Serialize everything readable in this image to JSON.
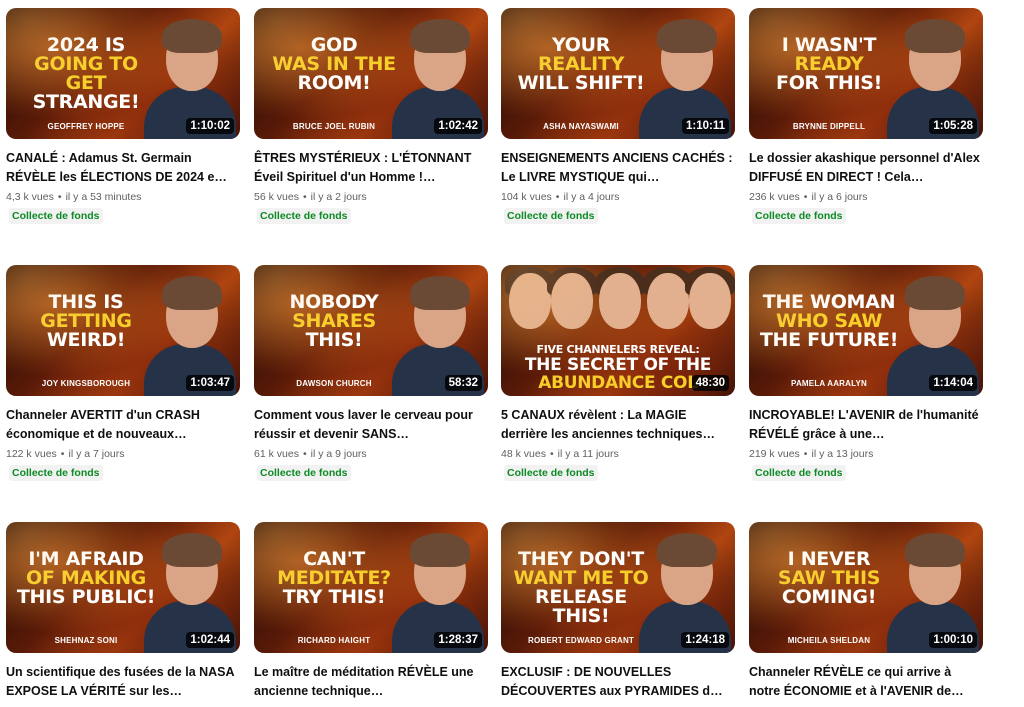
{
  "videos": [
    {
      "title": "CANALÉ : Adamus St. Germain RÉVÈLE les ÉLECTIONS DE 2024 e…",
      "views": "4,3 k vues",
      "age": "il y a 53 minutes",
      "badge": "Collecte de fonds",
      "duration": "1:10:02",
      "speaker": "GEOFFREY HOPPE",
      "headline": [
        {
          "text": "2024 IS",
          "color": "white"
        },
        {
          "text": "GOING TO GET",
          "color": "yellow"
        },
        {
          "text": "STRANGE!",
          "color": "white"
        }
      ]
    },
    {
      "title": "ÊTRES MYSTÉRIEUX : L'ÉTONNANT Éveil Spirituel d'un Homme !…",
      "views": "56 k vues",
      "age": "il y a 2 jours",
      "badge": "Collecte de fonds",
      "duration": "1:02:42",
      "speaker": "BRUCE JOEL RUBIN",
      "headline": [
        {
          "text": "GOD",
          "color": "white"
        },
        {
          "text": "WAS IN THE",
          "color": "yellow"
        },
        {
          "text": "ROOM!",
          "color": "white"
        }
      ]
    },
    {
      "title": "ENSEIGNEMENTS ANCIENS CACHÉS : Le LIVRE MYSTIQUE qui…",
      "views": "104 k vues",
      "age": "il y a 4 jours",
      "badge": "Collecte de fonds",
      "duration": "1:10:11",
      "speaker": "ASHA NAYASWAMI",
      "headline": [
        {
          "text": "YOUR",
          "color": "white"
        },
        {
          "text": "REALITY",
          "color": "yellow"
        },
        {
          "text": "WILL SHIFT!",
          "color": "white"
        }
      ]
    },
    {
      "title": "Le dossier akashique personnel d'Alex DIFFUSÉ EN DIRECT ! Cela…",
      "views": "236 k vues",
      "age": "il y a 6 jours",
      "badge": "Collecte de fonds",
      "duration": "1:05:28",
      "speaker": "BRYNNE DIPPELL",
      "headline": [
        {
          "text": "I WASN'T",
          "color": "white"
        },
        {
          "text": "READY",
          "color": "yellow"
        },
        {
          "text": "FOR THIS!",
          "color": "white"
        }
      ]
    },
    {
      "title": "Channeler AVERTIT d'un CRASH économique et de nouveaux…",
      "views": "122 k vues",
      "age": "il y a 7 jours",
      "badge": "Collecte de fonds",
      "duration": "1:03:47",
      "speaker": "JOY KINGSBOROUGH",
      "headline": [
        {
          "text": "THIS IS",
          "color": "white"
        },
        {
          "text": "GETTING",
          "color": "yellow"
        },
        {
          "text": "WEIRD!",
          "color": "white"
        }
      ]
    },
    {
      "title": "Comment vous laver le cerveau pour réussir et devenir SANS…",
      "views": "61 k vues",
      "age": "il y a 9 jours",
      "badge": "Collecte de fonds",
      "duration": "58:32",
      "speaker": "DAWSON CHURCH",
      "headline": [
        {
          "text": "NOBODY",
          "color": "white"
        },
        {
          "text": "SHARES",
          "color": "yellow"
        },
        {
          "text": "THIS!",
          "color": "white"
        }
      ]
    },
    {
      "title": "5 CANAUX révèlent : La MAGIE derrière les anciennes techniques…",
      "views": "48 k vues",
      "age": "il y a 11 jours",
      "badge": "Collecte de fonds",
      "duration": "48:30",
      "speaker": "",
      "wide": true,
      "headline": [
        {
          "text": "FIVE CHANNELERS REVEAL:",
          "color": "white"
        },
        {
          "text": "THE SECRET OF THE",
          "color": "white"
        },
        {
          "text": "ABUNDANCE COL",
          "color": "yellow"
        }
      ]
    },
    {
      "title": "INCROYABLE! L'AVENIR de l'humanité RÉVÉLÉ grâce à une…",
      "views": "219 k vues",
      "age": "il y a 13 jours",
      "badge": "Collecte de fonds",
      "duration": "1:14:04",
      "speaker": "PAMELA AARALYN",
      "headline": [
        {
          "text": "THE WOMAN",
          "color": "white"
        },
        {
          "text": "WHO SAW",
          "color": "yellow"
        },
        {
          "text": "THE FUTURE!",
          "color": "white"
        }
      ]
    },
    {
      "title": "Un scientifique des fusées de la NASA EXPOSE LA VÉRITÉ sur les…",
      "views": "",
      "age": "",
      "badge": "",
      "duration": "1:02:44",
      "speaker": "SHEHNAZ SONI",
      "headline": [
        {
          "text": "I'M AFRAID",
          "color": "white"
        },
        {
          "text": "OF MAKING",
          "color": "yellow"
        },
        {
          "text": "THIS PUBLIC!",
          "color": "white"
        }
      ]
    },
    {
      "title": "Le maître de méditation RÉVÈLE une ancienne technique…",
      "views": "",
      "age": "",
      "badge": "",
      "duration": "1:28:37",
      "speaker": "RICHARD HAIGHT",
      "headline": [
        {
          "text": "CAN'T",
          "color": "white"
        },
        {
          "text": "MEDITATE?",
          "color": "yellow"
        },
        {
          "text": "TRY THIS!",
          "color": "white"
        }
      ]
    },
    {
      "title": "EXCLUSIF : DE NOUVELLES DÉCOUVERTES aux PYRAMIDES d…",
      "views": "",
      "age": "",
      "badge": "",
      "duration": "1:24:18",
      "speaker": "ROBERT EDWARD GRANT",
      "headline": [
        {
          "text": "THEY DON'T",
          "color": "white"
        },
        {
          "text": "WANT ME TO",
          "color": "yellow"
        },
        {
          "text": "RELEASE THIS!",
          "color": "white"
        }
      ]
    },
    {
      "title": "Channeler RÉVÈLE ce qui arrive à notre ÉCONOMIE et à l'AVENIR de…",
      "views": "",
      "age": "",
      "badge": "",
      "duration": "1:00:10",
      "speaker": "MICHEILA SHELDAN",
      "headline": [
        {
          "text": "I NEVER",
          "color": "white"
        },
        {
          "text": "SAW THIS",
          "color": "yellow"
        },
        {
          "text": "COMING!",
          "color": "white"
        }
      ]
    }
  ]
}
